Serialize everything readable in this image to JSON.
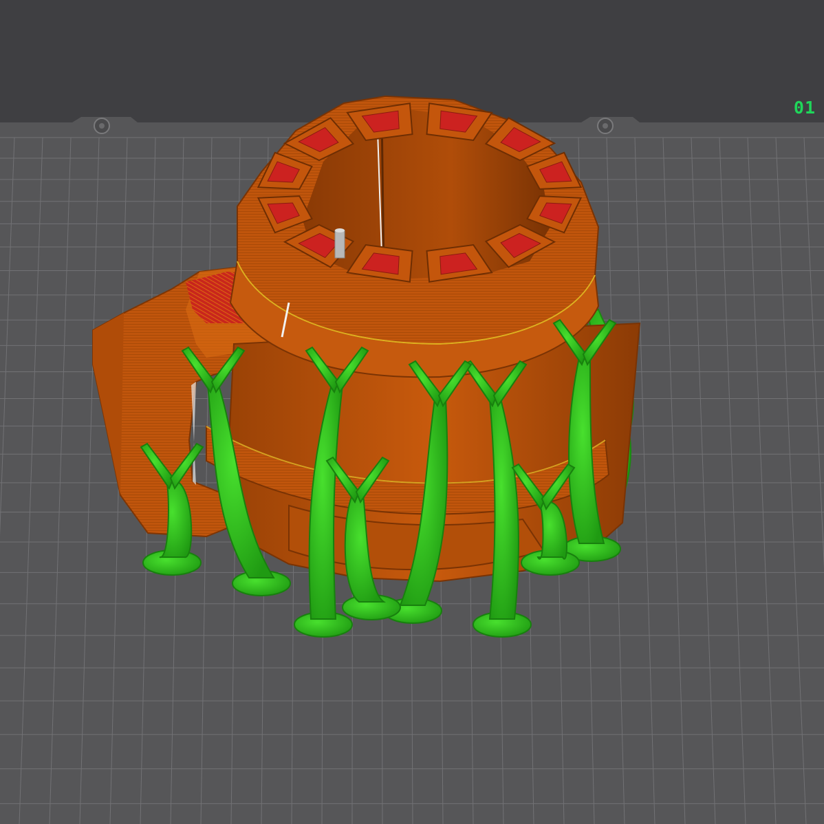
{
  "viewport": {
    "plate_label": "01",
    "colors": {
      "background": "#3f3f42",
      "plate": "#565658",
      "grid_line": "#707073",
      "model_orange": "#c0550c",
      "model_shade": "#8f3c06",
      "model_top_red": "#c8201e",
      "support_green": "#2ec41e",
      "support_dark": "#1a8a10",
      "plate_label_green": "#1fd65a"
    },
    "objects": [
      {
        "name": "mug-model",
        "icon": "sliced-model-preview"
      },
      {
        "name": "tree-supports",
        "icon": "support-structure"
      },
      {
        "name": "wipe-tower-pin",
        "icon": "small-cylinder"
      }
    ]
  }
}
